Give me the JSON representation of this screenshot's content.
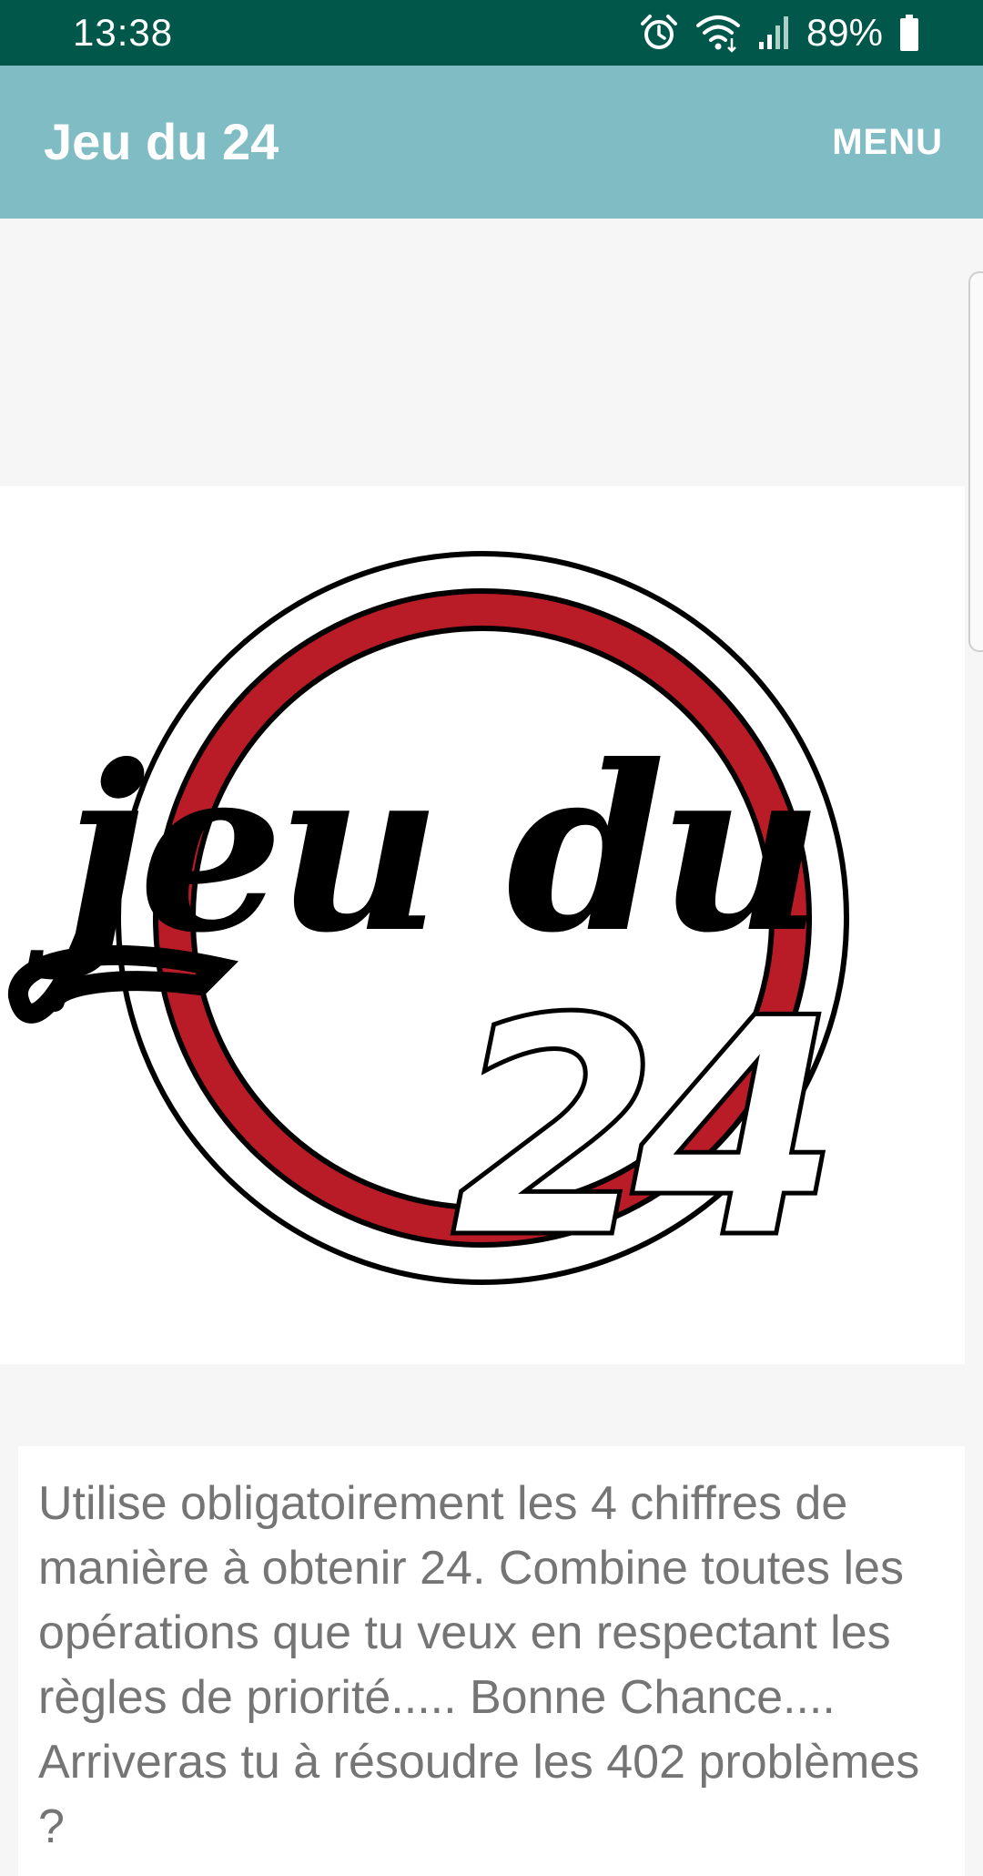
{
  "status_bar": {
    "time": "13:38",
    "battery": "89%",
    "icons": [
      "alarm-icon",
      "wifi-icon",
      "signal-icon",
      "battery-icon"
    ]
  },
  "app_bar": {
    "title": "Jeu du 24",
    "menu_label": "MENU"
  },
  "logo": {
    "word_text": "jeu du",
    "number_text": "24",
    "ring_color": "#b91c27"
  },
  "rules": {
    "text": "Utilise obligatoirement les 4 chiffres de manière à obtenir 24. Combine toutes les opérations que tu veux en respectant les règles de priorité..... Bonne Chance.... Arriveras tu à résoudre les 402 problèmes ?"
  },
  "colors": {
    "status_bar": "#01574a",
    "app_bar": "#80bcc3",
    "text": "#757575"
  }
}
